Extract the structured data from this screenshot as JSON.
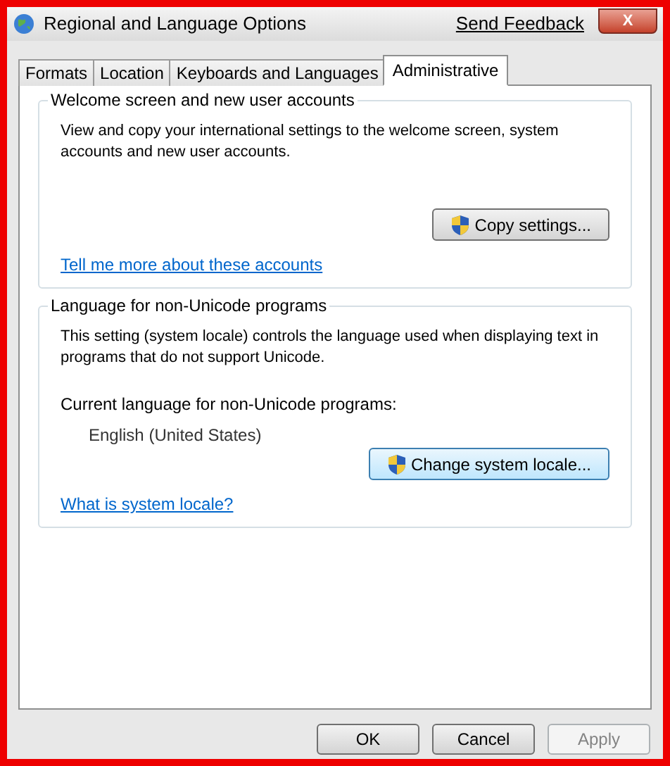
{
  "window": {
    "title": "Regional and Language Options",
    "feedback_link": "Send Feedback",
    "close_button": "X"
  },
  "tabs": [
    {
      "label": "Formats",
      "selected": false
    },
    {
      "label": "Location",
      "selected": false
    },
    {
      "label": "Keyboards and Languages",
      "selected": false
    },
    {
      "label": "Administrative",
      "selected": true
    }
  ],
  "groups": [
    {
      "title": "Welcome screen and new user accounts",
      "description": "View and copy your international settings to the welcome screen, system accounts and new user accounts.",
      "button": {
        "label": "Copy settings...",
        "focused": false
      },
      "link": "Tell me more about these accounts"
    },
    {
      "title": "Language for non-Unicode programs",
      "description": "This setting (system locale) controls the language used when displaying text in programs that do not support Unicode.",
      "current_label": "Current language for non-Unicode programs:",
      "current_value": "English (United States)",
      "button": {
        "label": "Change system locale...",
        "focused": true
      },
      "link": "What is system locale?"
    }
  ],
  "buttons": [
    {
      "label": "OK",
      "disabled": false
    },
    {
      "label": "Cancel",
      "disabled": false
    },
    {
      "label": "Apply",
      "disabled": true
    }
  ]
}
